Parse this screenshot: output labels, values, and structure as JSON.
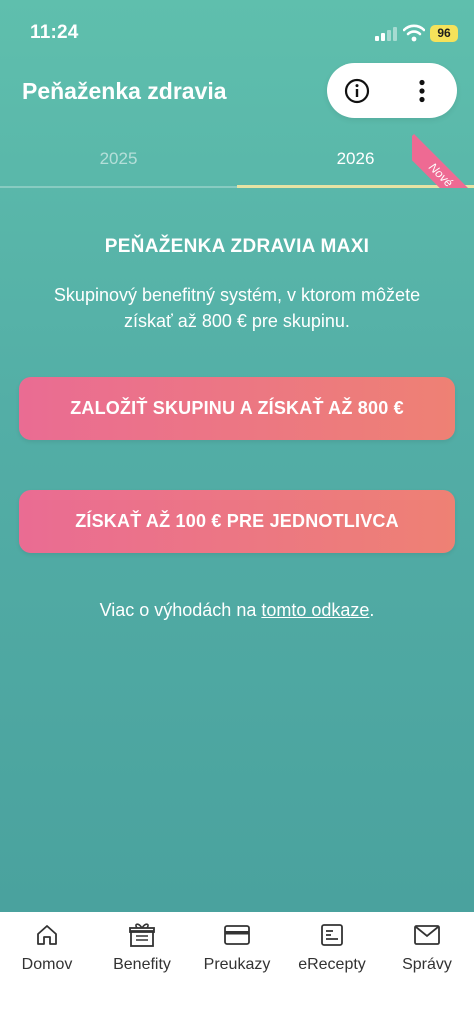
{
  "status_bar": {
    "time": "11:24",
    "battery": "96"
  },
  "header": {
    "title": "Peňaženka zdravia"
  },
  "tabs": [
    {
      "label": "2025",
      "active": false
    },
    {
      "label": "2026",
      "active": true
    }
  ],
  "badge": {
    "label": "Nové"
  },
  "content": {
    "heading": "PEŇAŽENKA ZDRAVIA MAXI",
    "description": "Skupinový benefitný systém, v ktorom môžete získať až 800 € pre skupinu.",
    "button_group": "ZALOŽIŤ SKUPINU A ZÍSKAŤ AŽ 800 €",
    "button_individual": "ZÍSKAŤ AŽ 100 € PRE JEDNOTLIVCA",
    "more_prefix": "Viac o výhodách na ",
    "more_link": "tomto odkaze",
    "more_suffix": "."
  },
  "bottom_nav": [
    {
      "label": "Domov",
      "icon": "home-icon"
    },
    {
      "label": "Benefity",
      "icon": "gift-icon"
    },
    {
      "label": "Preukazy",
      "icon": "card-icon"
    },
    {
      "label": "eRecepty",
      "icon": "prescription-icon"
    },
    {
      "label": "Správy",
      "icon": "mail-icon"
    }
  ],
  "colors": {
    "background": "#53aea6",
    "button_gradient_start": "#ea6c93",
    "button_gradient_end": "#ee8174",
    "tab_indicator": "#e6e3a4",
    "badge": "#ee6a93"
  }
}
